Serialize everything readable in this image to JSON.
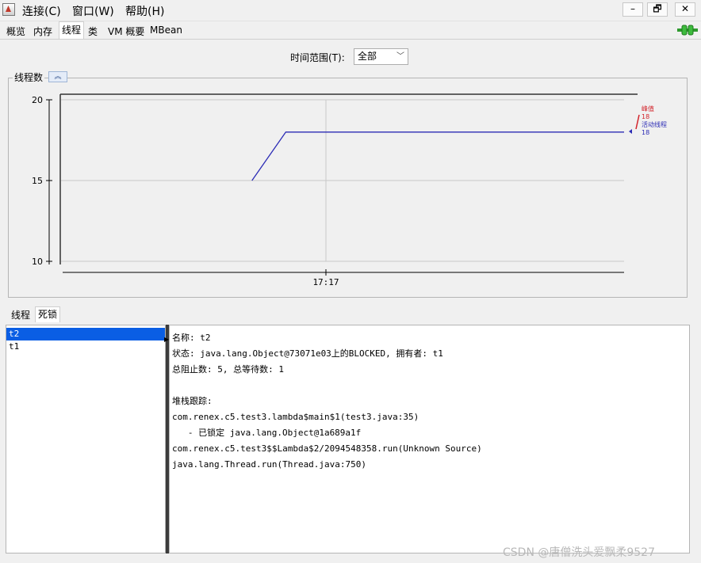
{
  "menu": [
    "连接(C)",
    "窗口(W)",
    "帮助(H)"
  ],
  "window_buttons": {
    "minimize": "–",
    "restore": "🗗",
    "close": "✕"
  },
  "tabs": [
    {
      "label": "概览",
      "active": false
    },
    {
      "label": "内存",
      "active": false
    },
    {
      "label": "线程",
      "active": true
    },
    {
      "label": "类",
      "active": false
    },
    {
      "label": "VM 概要",
      "active": false
    },
    {
      "label": "MBean",
      "active": false
    }
  ],
  "time_range": {
    "label": "时间范围(T):",
    "value": "全部"
  },
  "thread_panel": {
    "title": "线程数",
    "collapse_icon": "double-chevron-up"
  },
  "chart_data": {
    "type": "line",
    "title": "线程数",
    "xlabel": "",
    "ylabel": "",
    "ylim": [
      10,
      20
    ],
    "y_ticks": [
      "20",
      "15",
      "10"
    ],
    "x_ticks": [
      "17:17"
    ],
    "grid": true,
    "series": [
      {
        "name": "峰值",
        "color": "#d2232a",
        "value_label": "18"
      },
      {
        "name": "活动线程",
        "color": "#2b2bb5",
        "value_label": "18",
        "points": [
          [
            0.34,
            15
          ],
          [
            0.4,
            18
          ],
          [
            1.0,
            18
          ]
        ]
      }
    ]
  },
  "lower_tabs": [
    {
      "label": "线程",
      "active": false
    },
    {
      "label": "死锁",
      "active": true
    }
  ],
  "thread_list": [
    {
      "name": "t2",
      "selected": true
    },
    {
      "name": "t1",
      "selected": false
    }
  ],
  "detail": {
    "name_line": "名称: t2",
    "state_line": "状态: java.lang.Object@73071e03上的BLOCKED, 拥有者: t1",
    "counts_line": "总阻止数: 5, 总等待数: 1",
    "stack_header": "堆栈跟踪:",
    "stack": [
      "com.renex.c5.test3.lambda$main$1(test3.java:35)",
      "   - 已锁定 java.lang.Object@1a689a1f",
      "com.renex.c5.test3$$Lambda$2/2094548358.run(Unknown Source)",
      "java.lang.Thread.run(Thread.java:750)"
    ]
  },
  "watermark": "CSDN @唐僧洗头爱飘柔9527"
}
